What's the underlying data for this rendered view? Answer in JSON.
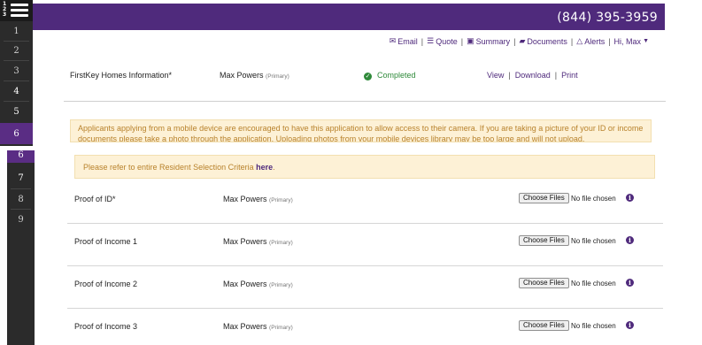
{
  "header": {
    "phone": "(844) 395-3959"
  },
  "sidebar": {
    "menu_numbers": [
      "1",
      "2",
      "3"
    ],
    "top_steps": [
      "1",
      "2",
      "3",
      "4",
      "5",
      "6"
    ],
    "bottom_steps": [
      "6",
      "7",
      "8",
      "9"
    ],
    "active_step": "6"
  },
  "nav": {
    "email": "Email",
    "quote": "Quote",
    "summary": "Summary",
    "documents": "Documents",
    "alerts": "Alerts",
    "user": "Hi, Max"
  },
  "info_row": {
    "title": "FirstKey Homes Information*",
    "name": "Max Powers",
    "role": "(Primary)",
    "status": "Completed",
    "view": "View",
    "download": "Download",
    "print": "Print"
  },
  "notice": {
    "text": "Applicants applying from a mobile device are encouraged to have this application to allow access to their camera. If you are taking a picture of your ID or income documents please take a photo through the application. Uploading photos from your mobile devices library may be too large and will not upload."
  },
  "criteria": {
    "text": "Please refer to entire Resident Selection Criteria ",
    "link": "here",
    "end": "."
  },
  "documents": [
    {
      "label": "Proof of ID*",
      "name": "Max Powers",
      "role": "(Primary)",
      "button": "Choose Files",
      "status": "No file chosen"
    },
    {
      "label": "Proof of Income 1",
      "name": "Max Powers",
      "role": "(Primary)",
      "button": "Choose Files",
      "status": "No file chosen"
    },
    {
      "label": "Proof of Income 2",
      "name": "Max Powers",
      "role": "(Primary)",
      "button": "Choose Files",
      "status": "No file chosen"
    },
    {
      "label": "Proof of Income 3",
      "name": "Max Powers",
      "role": "(Primary)",
      "button": "Choose Files",
      "status": "No file chosen"
    }
  ],
  "colors": {
    "brand": "#4f2a7c",
    "success": "#2f8a3a",
    "notice_bg": "#fdf1d6",
    "notice_text": "#b8822c"
  }
}
